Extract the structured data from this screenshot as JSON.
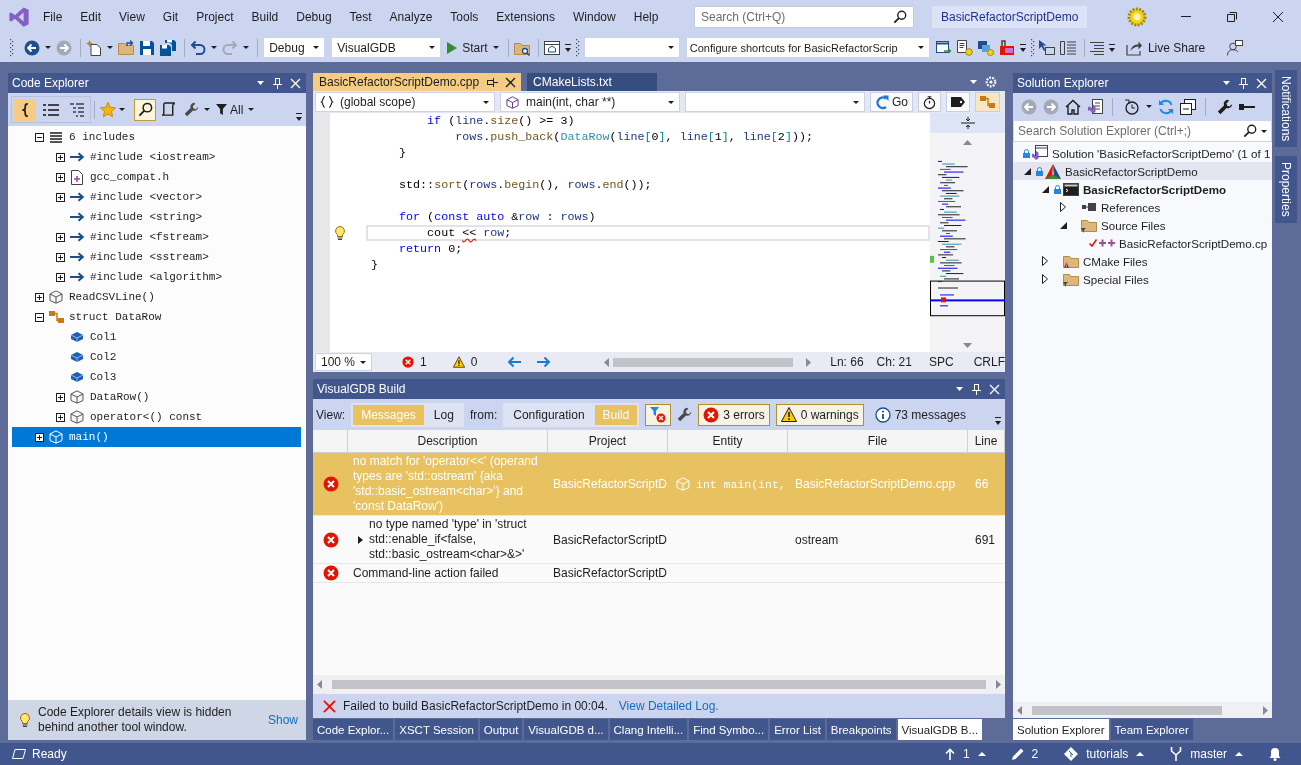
{
  "title_bar": {
    "menu": [
      "File",
      "Edit",
      "View",
      "Git",
      "Project",
      "Build",
      "Debug",
      "Test",
      "Analyze",
      "Tools",
      "Extensions",
      "Window",
      "Help"
    ],
    "search_placeholder": "Search (Ctrl+Q)",
    "solution_name": "BasicRefactorScriptDemo"
  },
  "toolbar": {
    "forward": {
      "disabled": true
    },
    "redo": {
      "disabled": true
    },
    "configuration": "Debug",
    "platform": "VisualGDB",
    "start": "Start",
    "shortcuts": "Configure shortcuts for BasicRefactorScrip",
    "live_share": "Live Share"
  },
  "code_explorer": {
    "title": "Code Explorer",
    "view_modes": [
      {
        "selected": true
      },
      {
        "selected": false
      },
      {
        "selected": false
      }
    ],
    "search": {
      "pressed": true
    },
    "filter": "All",
    "tree": [
      {
        "label": "6 includes",
        "kind": "includes",
        "expanded": true,
        "selected": false,
        "children": [
          {
            "label": "#include <iostream>",
            "kind": "include",
            "expanded": false,
            "selected": false
          },
          {
            "label": "gcc_compat.h",
            "kind": "header",
            "expanded": false,
            "selected": false
          },
          {
            "label": "#include <vector>",
            "kind": "include",
            "expanded": false,
            "selected": false
          },
          {
            "label": "#include <string>",
            "kind": "include",
            "selected": false
          },
          {
            "label": "#include <fstream>",
            "kind": "include",
            "expanded": false,
            "selected": false
          },
          {
            "label": "#include <sstream>",
            "kind": "include",
            "expanded": false,
            "selected": false
          },
          {
            "label": "#include <algorithm>",
            "kind": "include",
            "expanded": false,
            "selected": false
          }
        ]
      },
      {
        "label": "ReadCSVLine()",
        "kind": "function",
        "expanded": false,
        "selected": false
      },
      {
        "label": "struct DataRow",
        "kind": "struct",
        "expanded": true,
        "selected": false,
        "children": [
          {
            "label": "Col1",
            "kind": "field",
            "selected": false
          },
          {
            "label": "Col2",
            "kind": "field",
            "selected": false
          },
          {
            "label": "Col3",
            "kind": "field",
            "selected": false
          },
          {
            "label": "DataRow()",
            "kind": "function",
            "expanded": false,
            "selected": false
          },
          {
            "label": "operator<() const",
            "kind": "function",
            "expanded": false,
            "selected": false
          }
        ]
      },
      {
        "label": "main()",
        "kind": "function",
        "expanded": false,
        "selected": true
      }
    ],
    "hint": "Code Explorer details view is hidden behind another tool window.",
    "hint_action": "Show"
  },
  "editor": {
    "tabs": [
      {
        "label": "BasicRefactorScriptDemo.cpp",
        "selected": true
      },
      {
        "label": "CMakeLists.txt",
        "selected": false
      }
    ],
    "scope": "(global scope)",
    "member": "main(int, char **)",
    "go": "Go",
    "lines": [
      {
        "tokens": [
          {
            "text": "        if",
            "kind": "keyword"
          },
          {
            "text": " (",
            "kind": "plain"
          },
          {
            "text": "line",
            "kind": "variable"
          },
          {
            "text": ".",
            "kind": "plain"
          },
          {
            "text": "size",
            "kind": "function"
          },
          {
            "text": "() >= 3)",
            "kind": "plain"
          }
        ],
        "current": false,
        "lightbulb": false
      },
      {
        "tokens": [
          {
            "text": "            rows",
            "kind": "variable"
          },
          {
            "text": ".",
            "kind": "plain"
          },
          {
            "text": "push_back",
            "kind": "function"
          },
          {
            "text": "(",
            "kind": "plain"
          },
          {
            "text": "DataRow",
            "kind": "type"
          },
          {
            "text": "(",
            "kind": "plain"
          },
          {
            "text": "line",
            "kind": "variable"
          },
          {
            "text": "[",
            "kind": "operator"
          },
          {
            "text": "0",
            "kind": "plain"
          },
          {
            "text": "]",
            "kind": "operator"
          },
          {
            "text": ", ",
            "kind": "plain"
          },
          {
            "text": "line",
            "kind": "variable"
          },
          {
            "text": "[",
            "kind": "operator"
          },
          {
            "text": "1",
            "kind": "plain"
          },
          {
            "text": "]",
            "kind": "operator"
          },
          {
            "text": ", ",
            "kind": "plain"
          },
          {
            "text": "line",
            "kind": "variable"
          },
          {
            "text": "[",
            "kind": "operator"
          },
          {
            "text": "2",
            "kind": "plain"
          },
          {
            "text": "]",
            "kind": "operator"
          },
          {
            "text": "));",
            "kind": "plain"
          }
        ],
        "current": false,
        "lightbulb": false
      },
      {
        "tokens": [
          {
            "text": "    }",
            "kind": "plain"
          }
        ],
        "current": false,
        "lightbulb": false
      },
      {
        "current": false,
        "lightbulb": false
      },
      {
        "tokens": [
          {
            "text": "    std::",
            "kind": "plain"
          },
          {
            "text": "sort",
            "kind": "function"
          },
          {
            "text": "(",
            "kind": "plain"
          },
          {
            "text": "rows",
            "kind": "variable"
          },
          {
            "text": ".",
            "kind": "plain"
          },
          {
            "text": "begin",
            "kind": "function"
          },
          {
            "text": "(), ",
            "kind": "plain"
          },
          {
            "text": "rows",
            "kind": "variable"
          },
          {
            "text": ".",
            "kind": "plain"
          },
          {
            "text": "end",
            "kind": "function"
          },
          {
            "text": "());",
            "kind": "plain"
          }
        ],
        "current": false,
        "lightbulb": false
      },
      {
        "current": false,
        "lightbulb": false
      },
      {
        "tokens": [
          {
            "text": "    for",
            "kind": "keyword"
          },
          {
            "text": " (",
            "kind": "plain"
          },
          {
            "text": "const",
            "kind": "keyword"
          },
          {
            "text": " auto",
            "kind": "keyword"
          },
          {
            "text": " &",
            "kind": "plain"
          },
          {
            "text": "row",
            "kind": "variable"
          },
          {
            "text": " : ",
            "kind": "plain"
          },
          {
            "text": "rows",
            "kind": "variable"
          },
          {
            "text": ")",
            "kind": "plain"
          }
        ],
        "current": false,
        "lightbulb": false
      },
      {
        "tokens": [
          {
            "text": "        cout ",
            "kind": "plain"
          },
          {
            "text": "<<",
            "kind": "error"
          },
          {
            "text": " row",
            "kind": "variable"
          },
          {
            "text": ";",
            "kind": "plain"
          }
        ],
        "current": true,
        "lightbulb": true
      },
      {
        "tokens": [
          {
            "text": "    return",
            "kind": "keyword"
          },
          {
            "text": " 0;",
            "kind": "plain"
          }
        ],
        "current": false,
        "lightbulb": false
      },
      {
        "tokens": [
          {
            "text": "}",
            "kind": "plain"
          }
        ],
        "current": false,
        "lightbulb": false
      }
    ],
    "zoom": "100 %",
    "errors": "1",
    "warnings": "0",
    "line": "Ln: 66",
    "column": "Ch: 21",
    "indent": "SPC",
    "line_ending": "CRLF"
  },
  "build": {
    "title": "VisualGDB Build",
    "view_label": "View:",
    "views": [
      {
        "label": "Messages",
        "selected": true
      },
      {
        "label": "Log",
        "selected": false
      }
    ],
    "source_label": "from:",
    "sources": [
      {
        "label": "Configuration",
        "selected": false
      },
      {
        "label": "Build",
        "selected": true
      }
    ],
    "toggle": {
      "pressed": true
    },
    "filters": [
      {
        "kind": "error",
        "label": "3 errors",
        "pressed": true
      },
      {
        "kind": "warning",
        "label": "0 warnings",
        "pressed": true
      },
      {
        "kind": "info",
        "label": "73 messages",
        "pressed": false
      }
    ],
    "columns": [
      "Description",
      "Project",
      "Entity",
      "File",
      "Line"
    ],
    "rows": [
      {
        "description": "no match for 'operator<<' (operand types are 'std::ostream' {aka 'std::basic_ostream<char>'} and 'const DataRow')",
        "project": "BasicRefactorScriptD",
        "entity": "int main(int,",
        "file": "BasicRefactorScriptDemo.cpp",
        "line": "66",
        "selected": true
      },
      {
        "description": "no type named 'type' in 'struct std::enable_if<false, std::basic_ostream<char>&>'",
        "expanded": false,
        "project": "BasicRefactorScriptD",
        "file": "ostream",
        "line": "691",
        "selected": false
      },
      {
        "description": "Command-line action failed",
        "project": "BasicRefactorScriptD",
        "selected": false
      }
    ],
    "result": "Failed to build BasicRefactorScriptDemo in 00:04.",
    "result_link": "View Detailed Log."
  },
  "tool_tabs": [
    {
      "label": "Code Explor...",
      "selected": false
    },
    {
      "label": "XSCT Session",
      "selected": false
    },
    {
      "label": "Output",
      "selected": false
    },
    {
      "label": "VisualGDB d...",
      "selected": false
    },
    {
      "label": "Clang Intelli...",
      "selected": false
    },
    {
      "label": "Find Symbo...",
      "selected": false
    },
    {
      "label": "Error List",
      "selected": false
    },
    {
      "label": "Breakpoints",
      "selected": false
    },
    {
      "label": "VisualGDB B...",
      "selected": true
    }
  ],
  "solution_explorer": {
    "title": "Solution Explorer",
    "back": {
      "disabled": true
    },
    "forward": {
      "disabled": true
    },
    "search_placeholder": "Search Solution Explorer (Ctrl+;)",
    "tree": [
      {
        "label": "Solution 'BasicRefactorScriptDemo' (1 of 1",
        "kind": "solution",
        "locked": true,
        "selected": false,
        "children": [
          {
            "label": "BasicRefactorScriptDemo",
            "kind": "cmake_project",
            "locked": true,
            "expanded": true,
            "selected": true,
            "children": [
              {
                "label": "BasicRefactorScriptDemo",
                "kind": "project",
                "locked": true,
                "startup": true,
                "expanded": true,
                "selected": false,
                "children": [
                  {
                    "label": "References",
                    "kind": "references",
                    "locked": false,
                    "expanded": false,
                    "selected": false
                  },
                  {
                    "label": "Source Files",
                    "kind": "folder",
                    "locked": false,
                    "expanded": true,
                    "selected": false,
                    "children": [
                      {
                        "label": "BasicRefactorScriptDemo.cp",
                        "kind": "source",
                        "locked": false,
                        "modified": true,
                        "selected": false
                      }
                    ]
                  }
                ]
              },
              {
                "label": "CMake Files",
                "kind": "cmake_folder",
                "locked": false,
                "expanded": false,
                "selected": false
              },
              {
                "label": "Special Files",
                "kind": "special_folder",
                "locked": false,
                "expanded": false,
                "selected": false
              }
            ]
          }
        ]
      }
    ],
    "tabs": [
      {
        "label": "Solution Explorer",
        "selected": true
      },
      {
        "label": "Team Explorer",
        "selected": false
      }
    ]
  },
  "side_tabs": [
    "Notifications",
    "Properties"
  ],
  "status_bar": {
    "text": "Ready",
    "incoming": "1",
    "changes": "2",
    "repository": "tutorials",
    "branch": "master"
  }
}
